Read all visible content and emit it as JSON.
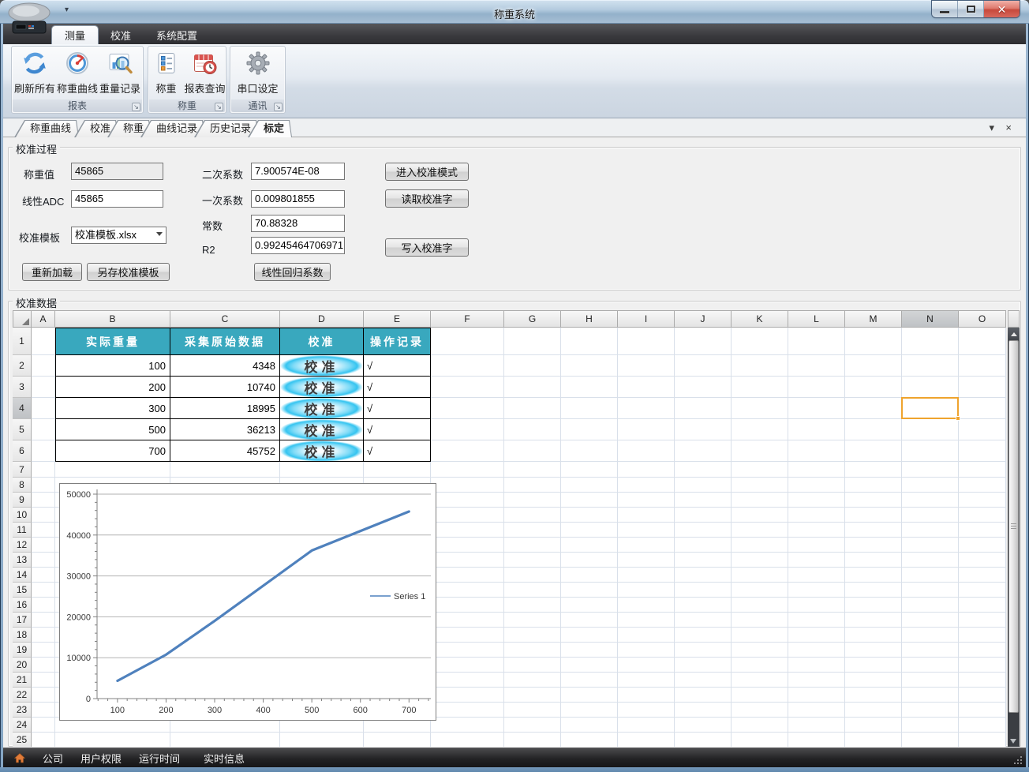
{
  "window": {
    "title": "称重系统"
  },
  "icons": {
    "app": "weighing-scale-icon",
    "refresh": "refresh-icon",
    "gauge": "gauge-icon",
    "chart_magnifier": "chart-magnifier-icon",
    "form_list": "form-list-icon",
    "calendar_clock": "calendar-clock-icon",
    "gear": "gear-icon",
    "home": "home-icon"
  },
  "ribbon": {
    "tabs": [
      {
        "label": "测量",
        "selected": true
      },
      {
        "label": "校准",
        "selected": false
      },
      {
        "label": "系统配置",
        "selected": false
      }
    ],
    "groups": [
      {
        "label": "报表",
        "buttons": [
          {
            "label": "刷新所有"
          },
          {
            "label": "称重曲线"
          },
          {
            "label": "重量记录"
          }
        ]
      },
      {
        "label": "称重",
        "buttons": [
          {
            "label": "称重"
          },
          {
            "label": "报表查询"
          }
        ]
      },
      {
        "label": "通讯",
        "buttons": [
          {
            "label": "串口设定"
          }
        ]
      }
    ]
  },
  "doc_tabs": [
    {
      "label": "称重曲线",
      "selected": false
    },
    {
      "label": "校准",
      "selected": false
    },
    {
      "label": "称重",
      "selected": false
    },
    {
      "label": "曲线记录",
      "selected": false
    },
    {
      "label": "历史记录",
      "selected": false
    },
    {
      "label": "标定",
      "selected": true
    }
  ],
  "calibration": {
    "group_title": "校准过程",
    "weight_label": "称重值",
    "weight_value": "45865",
    "adc_label": "线性ADC",
    "adc_value": "45865",
    "template_label": "校准模板",
    "template_value": "校准模板.xlsx",
    "quad_label": "二次系数",
    "quad_value": "7.900574E-08",
    "lin_label": "一次系数",
    "lin_value": "0.009801855",
    "const_label": "常数",
    "const_value": "70.88328",
    "r2_label": "R2",
    "r2_value": "0.99245464706971",
    "reload_btn": "重新加载",
    "saveas_btn": "另存校准模板",
    "regress_btn": "线性回归系数",
    "enter_btn": "进入校准模式",
    "read_btn": "读取校准字",
    "write_btn": "写入校准字"
  },
  "data_panel": {
    "group_title": "校准数据",
    "grid": {
      "columns": [
        "A",
        "B",
        "C",
        "D",
        "E",
        "F",
        "G",
        "H",
        "I",
        "J",
        "K",
        "L",
        "M",
        "N",
        "O"
      ],
      "row_count": 25,
      "selected": {
        "col": "N",
        "row": 4
      },
      "table": {
        "headers": [
          "实际重量",
          "采集原始数据",
          "校准",
          "操作记录"
        ],
        "rows": [
          [
            "100",
            "4348",
            "校准",
            "√"
          ],
          [
            "200",
            "10740",
            "校准",
            "√"
          ],
          [
            "300",
            "18995",
            "校准",
            "√"
          ],
          [
            "500",
            "36213",
            "校准",
            "√"
          ],
          [
            "700",
            "45752",
            "校准",
            "√"
          ]
        ]
      }
    }
  },
  "chart_data": {
    "type": "line",
    "x": [
      100,
      200,
      300,
      500,
      700
    ],
    "series": [
      {
        "name": "Series 1",
        "values": [
          4348,
          10740,
          18995,
          36213,
          45752
        ]
      }
    ],
    "title": "",
    "xlabel": "",
    "ylabel": "",
    "xlim": [
      58,
      745
    ],
    "ylim": [
      0,
      50000
    ],
    "x_ticks": [
      100,
      200,
      300,
      400,
      500,
      600,
      700
    ],
    "y_ticks": [
      0,
      10000,
      20000,
      30000,
      40000,
      50000
    ],
    "x_minor_step": 20,
    "y_minor_step": 2000,
    "grid": "horizontal",
    "legend_position": "right-middle",
    "line_color": "#4f81bd"
  },
  "status_bar": {
    "items": [
      "公司",
      "用户权限",
      "运行时间",
      "实时信息"
    ]
  },
  "colors": {
    "table_header_teal": "#39a8be",
    "glow_cyan": "#35c4f0",
    "selection_orange": "#efa42e",
    "chart_line_blue": "#4f81bd",
    "close_button_red": "#cf4a41"
  }
}
